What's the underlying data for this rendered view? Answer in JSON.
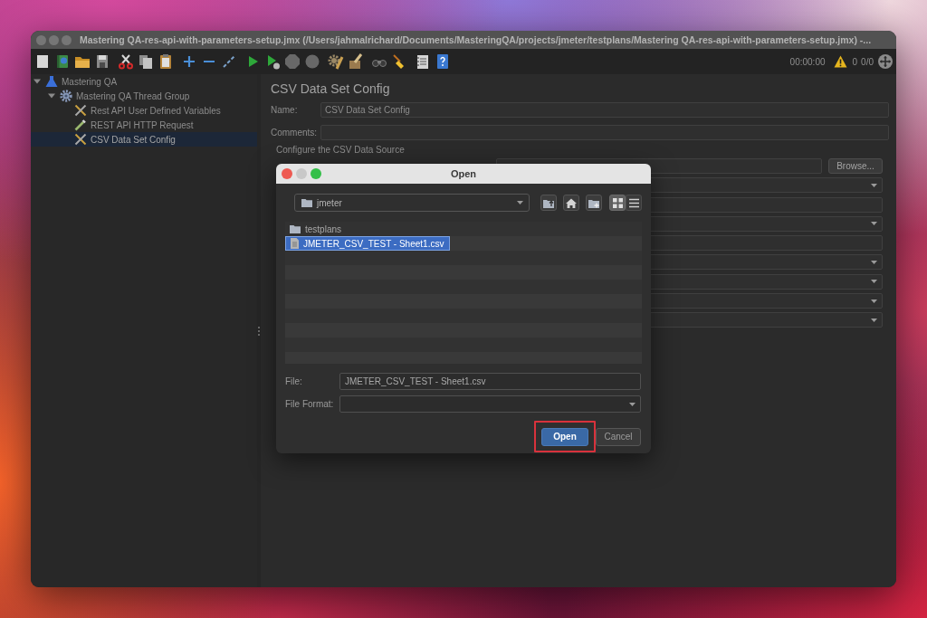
{
  "window": {
    "title": "Mastering QA-res-api-with-parameters-setup.jmx (/Users/jahmalrichard/Documents/MasteringQA/projects/jmeter/testplans/Mastering QA-res-api-with-parameters-setup.jmx) -...",
    "active": false
  },
  "toolbar": {
    "timer": "00:00:00",
    "warning_count": "0",
    "threads": "0/0"
  },
  "tree": [
    {
      "label": "Mastering QA",
      "kind": "test-plan",
      "expanded": true,
      "selected": false,
      "children": [
        {
          "label": "Mastering QA Thread Group",
          "kind": "thread-group",
          "expanded": true,
          "selected": false,
          "children": [
            {
              "label": "Rest API User Defined Variables",
              "kind": "config",
              "selected": false
            },
            {
              "label": "REST API HTTP Request",
              "kind": "sampler",
              "selected": false
            },
            {
              "label": "CSV Data Set Config",
              "kind": "config",
              "selected": true
            }
          ]
        }
      ]
    }
  ],
  "panel": {
    "title": "CSV Data Set Config",
    "fields": [
      {
        "label": "Name:",
        "value": "CSV Data Set Config"
      },
      {
        "label": "Comments:"
      }
    ],
    "section": "Configure the CSV Data Source",
    "rows": [
      {
        "kind": "file",
        "button": "Browse..."
      },
      {
        "kind": "dropdown"
      },
      {
        "kind": "text"
      },
      {
        "kind": "dropdown"
      },
      {
        "kind": "text"
      },
      {
        "kind": "dropdown"
      },
      {
        "kind": "dropdown"
      },
      {
        "kind": "dropdown"
      },
      {
        "kind": "dropdown"
      }
    ]
  },
  "dialog": {
    "title": "Open",
    "active": true,
    "location": "jmeter",
    "view_toggle": [
      {
        "kind": "grid",
        "selected": true
      },
      {
        "kind": "list",
        "selected": false
      }
    ],
    "files": [
      {
        "name": "testplans",
        "kind": "folder",
        "selected": false
      },
      {
        "name": "JMETER_CSV_TEST - Sheet1.csv",
        "kind": "file",
        "selected": true
      }
    ],
    "file_name": {
      "label": "File:",
      "value": "JMETER_CSV_TEST - Sheet1.csv"
    },
    "file_format": {
      "label": "File Format:"
    },
    "buttons": [
      {
        "label": "Open",
        "kind": "primary",
        "highlighted": true
      },
      {
        "label": "Cancel",
        "kind": "secondary",
        "highlighted": false
      }
    ]
  }
}
